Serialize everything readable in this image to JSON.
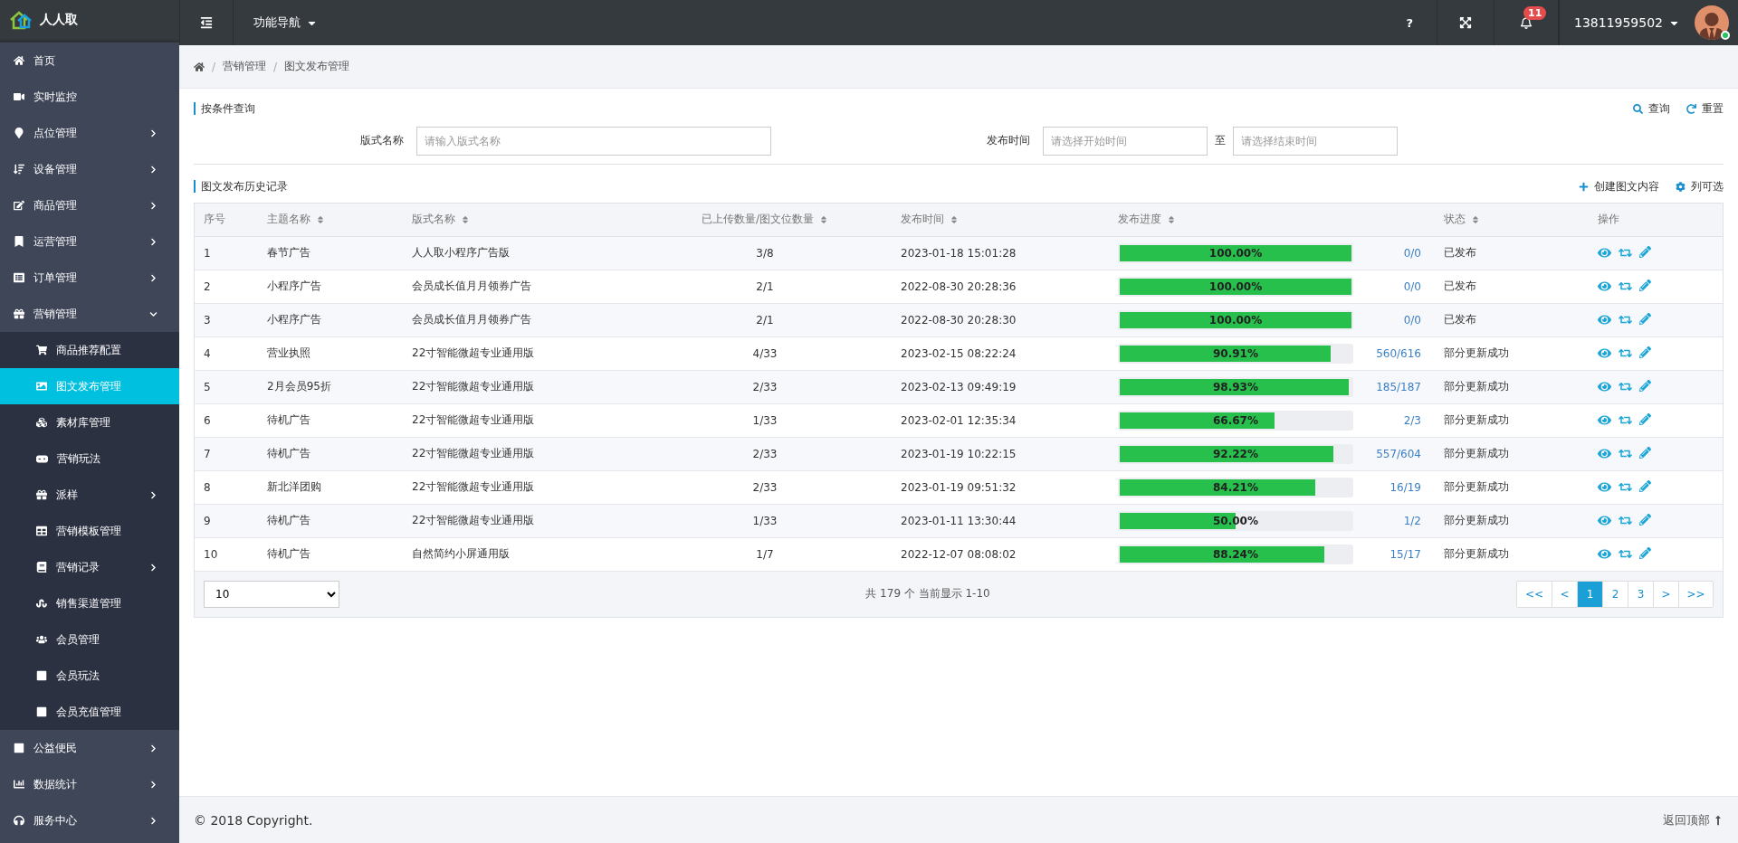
{
  "brand": {
    "name": "人人取"
  },
  "topbar": {
    "nav_menu": "功能导航",
    "help": "?",
    "notification_count": "11",
    "user": {
      "name": "13811959502",
      "online": true
    }
  },
  "sidebar": {
    "items": [
      {
        "label": "首页",
        "expandable": false,
        "expanded": false,
        "selected": false
      },
      {
        "label": "实时监控",
        "expandable": false,
        "expanded": false,
        "selected": false
      },
      {
        "label": "点位管理",
        "expandable": true,
        "expanded": false,
        "selected": false
      },
      {
        "label": "设备管理",
        "expandable": true,
        "expanded": false,
        "selected": false
      },
      {
        "label": "商品管理",
        "expandable": true,
        "expanded": false,
        "selected": false
      },
      {
        "label": "运营管理",
        "expandable": true,
        "expanded": false,
        "selected": false
      },
      {
        "label": "订单管理",
        "expandable": true,
        "expanded": false,
        "selected": false
      },
      {
        "label": "营销管理",
        "expandable": true,
        "expanded": true,
        "selected": false,
        "children": [
          {
            "label": "商品推荐配置",
            "expandable": false,
            "selected": false
          },
          {
            "label": "图文发布管理",
            "expandable": false,
            "selected": true
          },
          {
            "label": "素材库管理",
            "expandable": false,
            "selected": false
          },
          {
            "label": "营销玩法",
            "expandable": false,
            "selected": false
          },
          {
            "label": "派样",
            "expandable": true,
            "selected": false
          },
          {
            "label": "营销模板管理",
            "expandable": false,
            "selected": false
          },
          {
            "label": "营销记录",
            "expandable": true,
            "selected": false
          },
          {
            "label": "销售渠道管理",
            "expandable": false,
            "selected": false
          },
          {
            "label": "会员管理",
            "expandable": false,
            "selected": false
          },
          {
            "label": "会员玩法",
            "expandable": false,
            "selected": false
          },
          {
            "label": "会员充值管理",
            "expandable": false,
            "selected": false
          }
        ]
      },
      {
        "label": "公益便民",
        "expandable": true,
        "expanded": false,
        "selected": false
      },
      {
        "label": "数据统计",
        "expandable": true,
        "expanded": false,
        "selected": false
      },
      {
        "label": "服务中心",
        "expandable": true,
        "expanded": false,
        "selected": false
      }
    ]
  },
  "breadcrumb": {
    "separator": "/",
    "items": [
      "营销管理",
      "图文发布管理"
    ]
  },
  "query": {
    "title": "按条件查询",
    "actions": [
      "查询",
      "重置"
    ],
    "name_field": {
      "label": "版式名称",
      "placeholder": "请输入版式名称"
    },
    "time_field": {
      "label": "发布时间",
      "start_placeholder": "请选择开始时间",
      "separator": "至",
      "end_placeholder": "请选择结束时间"
    }
  },
  "history": {
    "title": "图文发布历史记录",
    "actions": [
      "创建图文内容",
      "列可选"
    ],
    "columns": [
      {
        "label": "序号",
        "sortable": false
      },
      {
        "label": "主题名称",
        "sortable": true
      },
      {
        "label": "版式名称",
        "sortable": true
      },
      {
        "label": "已上传数量/图文位数量",
        "sortable": true
      },
      {
        "label": "发布时间",
        "sortable": true
      },
      {
        "label": "发布进度",
        "sortable": true
      },
      {
        "label": "状态",
        "sortable": true
      },
      {
        "label": "操作",
        "sortable": false
      }
    ],
    "rows": [
      {
        "index": "1",
        "topic": "春节广告",
        "layout": "人人取小程序广告版",
        "uploaded": "3/8",
        "time": "2023-01-18 15:01:28",
        "level": 1,
        "percent": "100.00%",
        "count": "0/0",
        "status": "已发布"
      },
      {
        "index": "2",
        "topic": "小程序广告",
        "layout": "会员成长值月月领券广告",
        "uploaded": "2/1",
        "time": "2022-08-30 20:28:36",
        "level": 1,
        "percent": "100.00%",
        "count": "0/0",
        "status": "已发布"
      },
      {
        "index": "3",
        "topic": "小程序广告",
        "layout": "会员成长值月月领券广告",
        "uploaded": "2/1",
        "time": "2022-08-30 20:28:30",
        "level": 1,
        "percent": "100.00%",
        "count": "0/0",
        "status": "已发布"
      },
      {
        "index": "4",
        "topic": "营业执照",
        "layout": "22寸智能微超专业通用版",
        "uploaded": "4/33",
        "time": "2023-02-15 08:22:24",
        "level": 0.9091,
        "percent": "90.91%",
        "count": "560/616",
        "status": "部分更新成功"
      },
      {
        "index": "5",
        "topic": "2月会员95折",
        "layout": "22寸智能微超专业通用版",
        "uploaded": "2/33",
        "time": "2023-02-13 09:49:19",
        "level": 0.9893,
        "percent": "98.93%",
        "count": "185/187",
        "status": "部分更新成功"
      },
      {
        "index": "6",
        "topic": "待机广告",
        "layout": "22寸智能微超专业通用版",
        "uploaded": "1/33",
        "time": "2023-02-01 12:35:34",
        "level": 0.6667,
        "percent": "66.67%",
        "count": "2/3",
        "status": "部分更新成功"
      },
      {
        "index": "7",
        "topic": "待机广告",
        "layout": "22寸智能微超专业通用版",
        "uploaded": "2/33",
        "time": "2023-01-19 10:22:15",
        "level": 0.9222,
        "percent": "92.22%",
        "count": "557/604",
        "status": "部分更新成功"
      },
      {
        "index": "8",
        "topic": "新北洋团购",
        "layout": "22寸智能微超专业通用版",
        "uploaded": "2/33",
        "time": "2023-01-19 09:51:32",
        "level": 0.8421,
        "percent": "84.21%",
        "count": "16/19",
        "status": "部分更新成功"
      },
      {
        "index": "9",
        "topic": "待机广告",
        "layout": "22寸智能微超专业通用版",
        "uploaded": "1/33",
        "time": "2023-01-11 13:30:44",
        "level": 0.5,
        "percent": "50.00%",
        "count": "1/2",
        "status": "部分更新成功"
      },
      {
        "index": "10",
        "topic": "待机广告",
        "layout": "自然简约小屏通用版",
        "uploaded": "1/7",
        "time": "2022-12-07 08:08:02",
        "level": 0.8824,
        "percent": "88.24%",
        "count": "15/17",
        "status": "部分更新成功"
      }
    ],
    "page_size": "10",
    "summary": "共 179 个 当前显示 1-10",
    "pages": [
      {
        "label": "<<",
        "selected": false
      },
      {
        "label": "<",
        "selected": false
      },
      {
        "label": "1",
        "selected": true
      },
      {
        "label": "2",
        "selected": false
      },
      {
        "label": "3",
        "selected": false
      },
      {
        "label": ">",
        "selected": false
      },
      {
        "label": ">>",
        "selected": false
      }
    ]
  },
  "footer": {
    "copyright": "© 2018 Copyright.",
    "back_to_top": "返回顶部"
  }
}
